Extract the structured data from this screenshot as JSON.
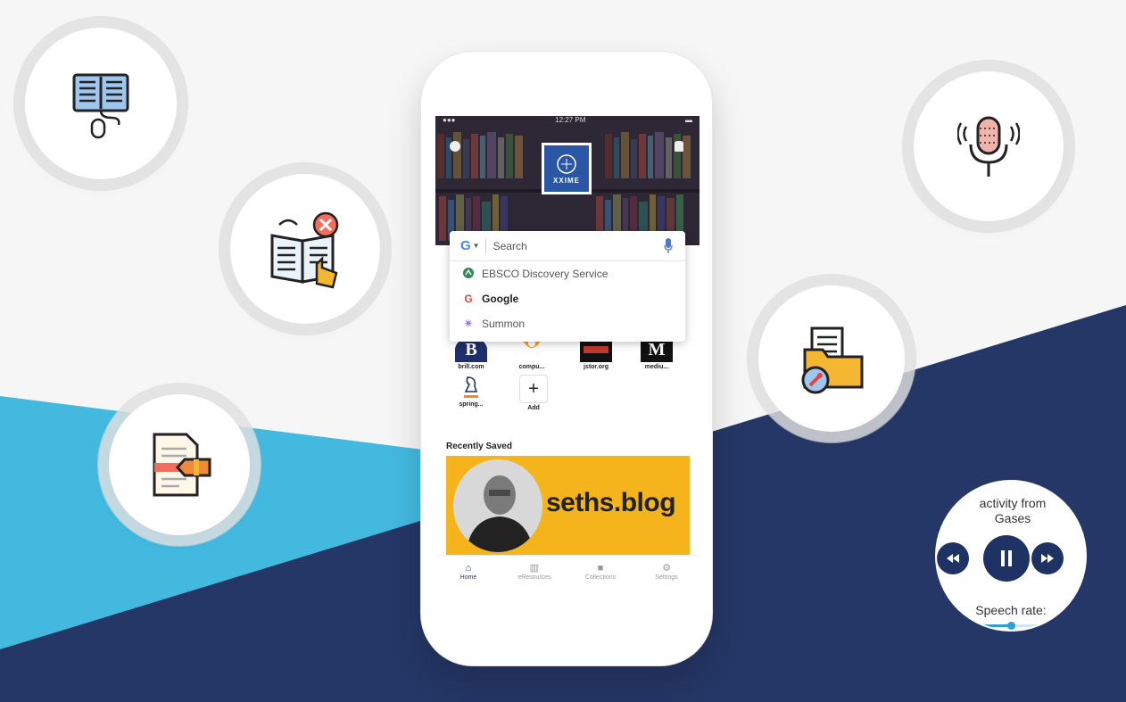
{
  "colors": {
    "navy": "#253766",
    "cyan": "#43b9e0",
    "accent": "#1f3264"
  },
  "feature_icons": [
    {
      "name": "ebook-mouse-icon"
    },
    {
      "name": "offline-book-touch-icon"
    },
    {
      "name": "document-highlighter-icon"
    },
    {
      "name": "podcast-microphone-icon"
    },
    {
      "name": "folder-pin-icon"
    }
  ],
  "phone": {
    "status_time": "12:27 PM",
    "logo_text": "XXIME",
    "search": {
      "engine_icon": "G",
      "placeholder": "Search",
      "options": [
        {
          "icon": "ebsco-icon",
          "label": "EBSCO Discovery Service"
        },
        {
          "icon": "google-icon",
          "label": "Google"
        },
        {
          "icon": "summon-icon",
          "label": "Summon"
        }
      ]
    },
    "tiles": [
      {
        "label": "brill.com",
        "glyph": "B"
      },
      {
        "label": "compu...",
        "glyph": ""
      },
      {
        "label": "jstor.org",
        "glyph": ""
      },
      {
        "label": "mediu...",
        "glyph": "M"
      },
      {
        "label": "spring...",
        "glyph": ""
      },
      {
        "label": "Add",
        "glyph": "+"
      }
    ],
    "recently_saved_title": "Recently Saved",
    "banner_brand": "seths.blog",
    "tabs": [
      {
        "label": "Home",
        "active": true
      },
      {
        "label": "eResources",
        "active": false
      },
      {
        "label": "Collections",
        "active": false
      },
      {
        "label": "Settings",
        "active": false
      }
    ]
  },
  "player": {
    "title_line1": "activity from",
    "title_line2": "Gases",
    "speech_rate_label": "Speech rate:",
    "speech_rate_fraction": 0.5
  }
}
